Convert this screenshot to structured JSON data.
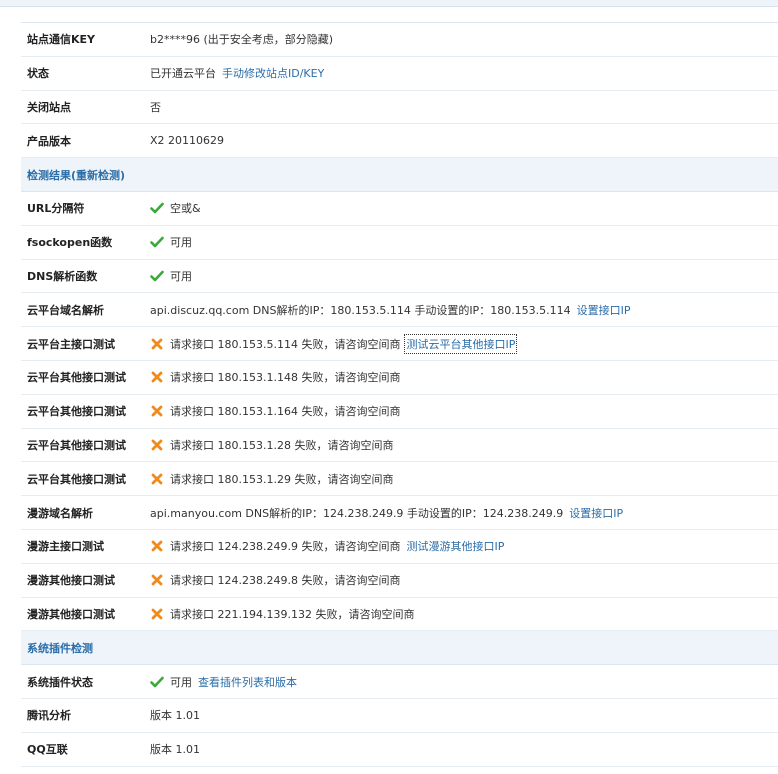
{
  "basic": [
    {
      "label": "站点通信KEY",
      "text": "b2****96 (出于安全考虑，部分隐藏)"
    },
    {
      "label": "状态",
      "text": "已开通云平台",
      "link": "手动修改站点ID/KEY"
    },
    {
      "label": "关闭站点",
      "text": "否"
    },
    {
      "label": "产品版本",
      "text": "X2 20110629"
    }
  ],
  "detect_section": "检测结果(重新检测)",
  "detect": [
    {
      "label": "URL分隔符",
      "status": "ok",
      "text": "空或&"
    },
    {
      "label": "fsockopen函数",
      "status": "ok",
      "text": "可用"
    },
    {
      "label": "DNS解析函数",
      "status": "ok",
      "text": "可用"
    },
    {
      "label": "云平台域名解析",
      "status": "none",
      "text": "api.discuz.qq.com DNS解析的IP：180.153.5.114 手动设置的IP：180.153.5.114",
      "link": "设置接口IP"
    },
    {
      "label": "云平台主接口测试",
      "status": "fail",
      "text": "请求接口  180.153.5.114 失败，请咨询空间商",
      "link": "测试云平台其他接口IP",
      "focused": true
    },
    {
      "label": "云平台其他接口测试",
      "status": "fail",
      "text": "请求接口  180.153.1.148 失败，请咨询空间商"
    },
    {
      "label": "云平台其他接口测试",
      "status": "fail",
      "text": "请求接口  180.153.1.164 失败，请咨询空间商"
    },
    {
      "label": "云平台其他接口测试",
      "status": "fail",
      "text": "请求接口  180.153.1.28 失败，请咨询空间商"
    },
    {
      "label": "云平台其他接口测试",
      "status": "fail",
      "text": "请求接口  180.153.1.29 失败，请咨询空间商"
    },
    {
      "label": "漫游域名解析",
      "status": "none",
      "text": "api.manyou.com DNS解析的IP：124.238.249.9 手动设置的IP：124.238.249.9",
      "link": "设置接口IP"
    },
    {
      "label": "漫游主接口测试",
      "status": "fail",
      "text": "请求接口  124.238.249.9 失败，请咨询空间商",
      "link": "测试漫游其他接口IP"
    },
    {
      "label": "漫游其他接口测试",
      "status": "fail",
      "text": "请求接口  124.238.249.8 失败，请咨询空间商"
    },
    {
      "label": "漫游其他接口测试",
      "status": "fail",
      "text": "请求接口  221.194.139.132 失败，请咨询空间商"
    }
  ],
  "plugin_section": "系统插件检测",
  "plugins": [
    {
      "label": "系统插件状态",
      "status": "ok",
      "text": "可用",
      "link": "查看插件列表和版本"
    },
    {
      "label": "腾讯分析",
      "status": "none",
      "text": "版本 1.01"
    },
    {
      "label": "QQ互联",
      "status": "none",
      "text": "版本 1.01"
    }
  ],
  "colors": {
    "ok": "#3aa83a",
    "fail": "#f08a1c",
    "link": "#2b6da8",
    "section_bg": "#eef4fa"
  }
}
